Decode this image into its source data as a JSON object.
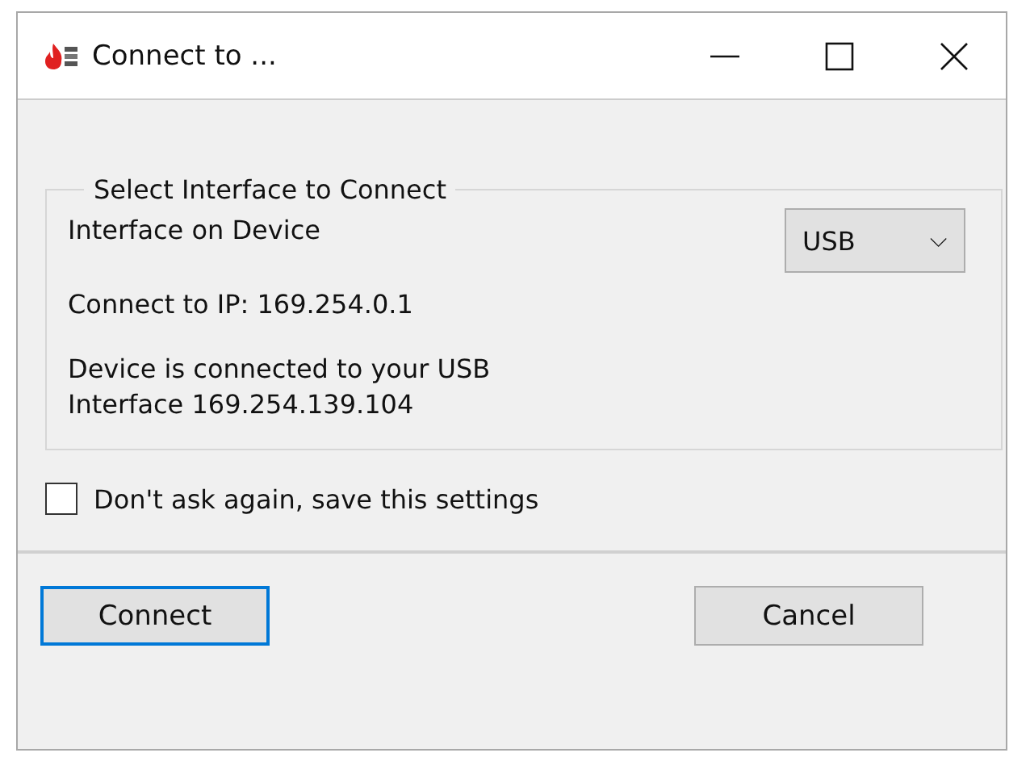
{
  "window": {
    "title": "Connect to ..."
  },
  "group": {
    "title": "Select Interface to Connect",
    "interface": {
      "label": "Interface on Device",
      "value": "USB",
      "caret": "⌵"
    },
    "ip_line": "Connect to IP: 169.254.0.1",
    "status_lines": [
      "Device is connected to your USB",
      "Interface 169.254.139.104"
    ]
  },
  "checkbox": {
    "label": "Don't ask again, save this settings",
    "checked": false
  },
  "buttons": [
    {
      "label": "Connect",
      "default": true
    },
    {
      "label": "Cancel",
      "default": false
    }
  ]
}
